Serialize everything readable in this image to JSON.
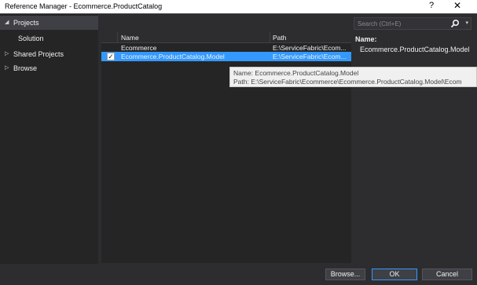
{
  "window": {
    "title": "Reference Manager - Ecommerce.ProductCatalog",
    "help_label": "?",
    "close_label": "✕"
  },
  "nav": {
    "items": [
      {
        "label": "Projects",
        "arrow": "◢",
        "selected": true
      },
      {
        "label": "Solution",
        "arrow": "",
        "selected": false
      },
      {
        "label": "Shared Projects",
        "arrow": "▷",
        "selected": false
      },
      {
        "label": "Browse",
        "arrow": "▷",
        "selected": false
      }
    ]
  },
  "search": {
    "placeholder": "Search (Ctrl+E)",
    "dropdown_glyph": "▾"
  },
  "grid": {
    "columns": [
      "Name",
      "Path"
    ],
    "rows": [
      {
        "name": "Ecommerce",
        "path": "E:\\ServiceFabric\\Ecom...",
        "checked": false,
        "selected": false
      },
      {
        "name": "Ecommerce.ProductCatalog.Model",
        "path": "E:\\ServiceFabric\\Ecom...",
        "checked": true,
        "selected": true
      }
    ]
  },
  "details": {
    "name_label": "Name:",
    "name_value": "Ecommerce.ProductCatalog.Model"
  },
  "tooltip": {
    "line1": "Name: Ecommerce.ProductCatalog.Model",
    "line2": "Path: E:\\ServiceFabric\\Ecommerce\\Ecommerce.ProductCatalog.Model\\Ecom"
  },
  "buttons": {
    "browse": "Browse...",
    "ok": "OK",
    "cancel": "Cancel"
  },
  "colors": {
    "background": "#2d2d30",
    "selection": "#3399ff",
    "panel": "#252526"
  }
}
